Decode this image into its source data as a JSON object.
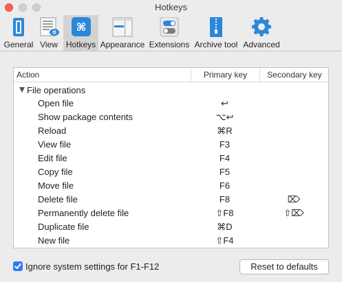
{
  "window": {
    "title": "Hotkeys"
  },
  "toolbar": {
    "items": [
      {
        "label": "General",
        "icon": "general-icon",
        "selected": false
      },
      {
        "label": "View",
        "icon": "view-icon",
        "selected": false
      },
      {
        "label": "Hotkeys",
        "icon": "command-key-icon",
        "selected": true
      },
      {
        "label": "Appearance",
        "icon": "appearance-icon",
        "selected": false
      },
      {
        "label": "Extensions",
        "icon": "toggles-icon",
        "selected": false
      },
      {
        "label": "Archive tool",
        "icon": "archive-icon",
        "selected": false
      },
      {
        "label": "Advanced",
        "icon": "gear-icon",
        "selected": false
      }
    ]
  },
  "table": {
    "headers": {
      "action": "Action",
      "primary": "Primary key",
      "secondary": "Secondary key"
    },
    "group": {
      "label": "File operations",
      "expanded": true
    },
    "rows": [
      {
        "action": "Open file",
        "primary": "↩",
        "secondary": ""
      },
      {
        "action": "Show package contents",
        "primary": "⌥↩",
        "secondary": ""
      },
      {
        "action": "Reload",
        "primary": "⌘R",
        "secondary": ""
      },
      {
        "action": "View file",
        "primary": "F3",
        "secondary": ""
      },
      {
        "action": "Edit file",
        "primary": "F4",
        "secondary": ""
      },
      {
        "action": "Copy file",
        "primary": "F5",
        "secondary": ""
      },
      {
        "action": "Move file",
        "primary": "F6",
        "secondary": ""
      },
      {
        "action": "Delete file",
        "primary": "F8",
        "secondary": "⌦"
      },
      {
        "action": "Permanently delete file",
        "primary": "⇧F8",
        "secondary": "⇧⌦"
      },
      {
        "action": "Duplicate file",
        "primary": "⌘D",
        "secondary": ""
      },
      {
        "action": "New file",
        "primary": "⇧F4",
        "secondary": ""
      }
    ]
  },
  "footer": {
    "ignore_checkbox": {
      "label": "Ignore system settings for F1-F12",
      "checked": true
    },
    "reset_label": "Reset to defaults"
  },
  "colors": {
    "accent": "#2f7bf5",
    "close": "#fd5f57"
  }
}
